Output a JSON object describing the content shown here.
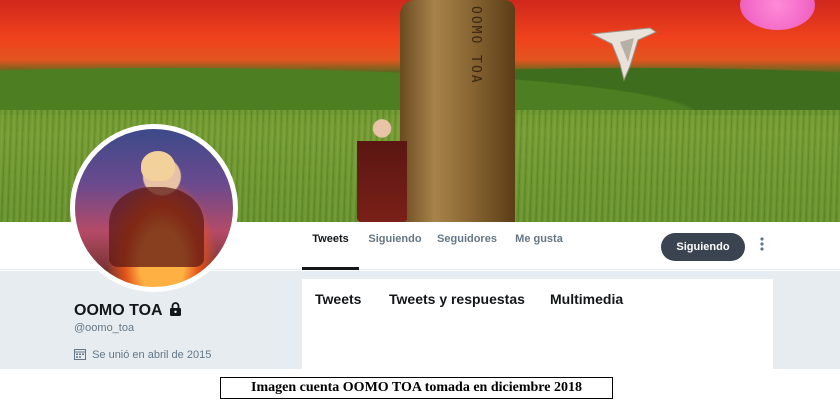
{
  "profile": {
    "display_name": "OOMO TOA",
    "handle": "@oomo_toa",
    "joined": "Se unió en abril de 2015",
    "locked_icon": "lock-icon",
    "calendar_icon": "calendar-icon"
  },
  "banner": {
    "pillar_glyphs": "OOMO TOA"
  },
  "nav": {
    "tabs": [
      {
        "label": "Tweets",
        "active": true
      },
      {
        "label": "Siguiendo",
        "active": false
      },
      {
        "label": "Seguidores",
        "active": false
      },
      {
        "label": "Me gusta",
        "active": false
      }
    ],
    "follow_button": "Siguiendo",
    "more_icon": "more-vertical-icon"
  },
  "timeline": {
    "tabs": [
      {
        "label": "Tweets"
      },
      {
        "label": "Tweets y respuestas"
      },
      {
        "label": "Multimedia"
      }
    ]
  },
  "caption": "Imagen cuenta OOMO TOA tomada en diciembre 2018",
  "colors": {
    "follow_button_bg": "#3a4350",
    "text_primary": "#14171a",
    "text_secondary": "#657786",
    "page_bg": "#e6ecf0"
  }
}
